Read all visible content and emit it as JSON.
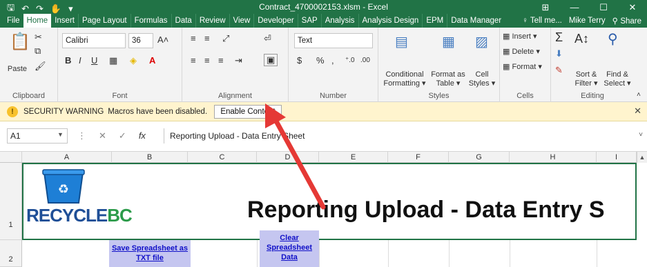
{
  "window": {
    "title": "Contract_4700002153.xlsm - Excel",
    "controls": [
      "⊞",
      "—",
      "☐",
      "✕"
    ]
  },
  "quick_access": [
    "save-icon",
    "undo-icon",
    "redo-icon",
    "touch-mode-icon",
    "customize-icon"
  ],
  "tabs": [
    "File",
    "Home",
    "Insert",
    "Page Layout",
    "Formulas",
    "Data",
    "Review",
    "View",
    "Developer",
    "SAP",
    "Analysis",
    "Analysis Design",
    "EPM",
    "Data Manager"
  ],
  "tell_me": "Tell me...",
  "user": "Mike Terry",
  "share": "Share",
  "ribbon": {
    "clipboard": {
      "paste": "Paste",
      "label": "Clipboard"
    },
    "font": {
      "name": "Calibri",
      "size": "36",
      "label": "Font",
      "bold": "B",
      "italic": "I",
      "underline": "U"
    },
    "alignment": {
      "label": "Alignment"
    },
    "number": {
      "format": "Text",
      "currency": "$",
      "percent": "%",
      "comma": ",",
      "label": "Number"
    },
    "styles": {
      "conditional": "Conditional",
      "formatting": "Formatting",
      "format_as": "Format as",
      "table": "Table",
      "cell": "Cell",
      "styles_btn": "Styles",
      "label": "Styles"
    },
    "cells": {
      "insert": "Insert",
      "delete": "Delete",
      "format": "Format",
      "label": "Cells"
    },
    "editing": {
      "sort": "Sort &",
      "filter": "Filter",
      "find": "Find &",
      "select": "Select",
      "label": "Editing"
    }
  },
  "security": {
    "title": "SECURITY WARNING",
    "message": "Macros have been disabled.",
    "button": "Enable Content"
  },
  "formula_bar": {
    "name_box": "A1",
    "formula": "Reporting Upload - Data Entry Sheet"
  },
  "grid": {
    "columns": [
      "A",
      "B",
      "C",
      "D",
      "E",
      "F",
      "G",
      "H",
      "I"
    ],
    "rows": [
      "1",
      "2"
    ],
    "title": "Reporting Upload - Data Entry S",
    "brand_left": "RECYCLE",
    "brand_right": "BC",
    "save_button_line1": "Save Spreadsheet as",
    "save_button_line2": "TXT file",
    "clear_button_line1": "Clear",
    "clear_button_line2": "Spreadsheet",
    "clear_button_line3": "Data"
  },
  "colors": {
    "excel_green": "#217346",
    "warning_bar": "#fff4ce",
    "arrow_red": "#e53935",
    "macro_button": "#c5c6f0",
    "link_blue": "#1010c8"
  }
}
